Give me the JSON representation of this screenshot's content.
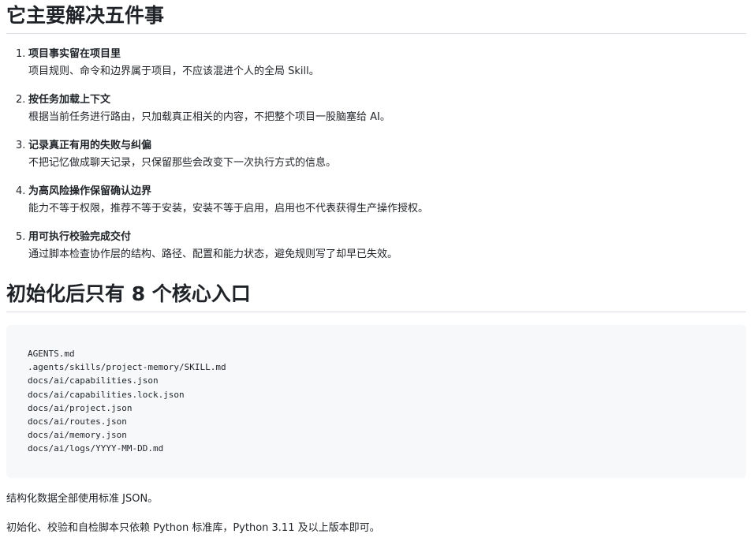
{
  "sections": {
    "five_things": {
      "heading": "它主要解决五件事",
      "items": [
        {
          "num": "1.",
          "title": "项目事实留在项目里",
          "desc": "项目规则、命令和边界属于项目，不应该混进个人的全局 Skill。"
        },
        {
          "num": "2.",
          "title": "按任务加载上下文",
          "desc": "根据当前任务进行路由，只加载真正相关的内容，不把整个项目一股脑塞给 AI。"
        },
        {
          "num": "3.",
          "title": "记录真正有用的失败与纠偏",
          "desc": "不把记忆做成聊天记录，只保留那些会改变下一次执行方式的信息。"
        },
        {
          "num": "4.",
          "title": "为高风险操作保留确认边界",
          "desc": "能力不等于权限，推荐不等于安装，安装不等于启用，启用也不代表获得生产操作授权。"
        },
        {
          "num": "5.",
          "title": "用可执行校验完成交付",
          "desc": "通过脚本检查协作层的结构、路径、配置和能力状态，避免规则写了却早已失效。"
        }
      ]
    },
    "entries": {
      "heading": "初始化后只有 8 个核心入口",
      "code_lines": [
        "AGENTS.md",
        ".agents/skills/project-memory/SKILL.md",
        "docs/ai/capabilities.json",
        "docs/ai/capabilities.lock.json",
        "docs/ai/project.json",
        "docs/ai/routes.json",
        "docs/ai/memory.json",
        "docs/ai/logs/YYYY-MM-DD.md"
      ],
      "paragraphs": [
        "结构化数据全部使用标准 JSON。",
        "初始化、校验和自检脚本只依赖 Python 标准库，Python 3.11 及以上版本即可。"
      ]
    }
  }
}
